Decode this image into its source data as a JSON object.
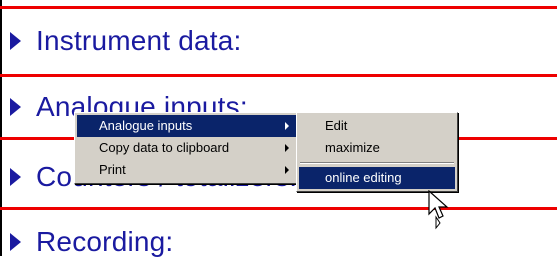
{
  "sections": [
    {
      "label": "Instrument data:"
    },
    {
      "label": "Analogue inputs:"
    },
    {
      "label": "Counters / totalizers:"
    },
    {
      "label": "Recording:"
    }
  ],
  "context_menu": {
    "items": [
      {
        "label": "Analogue inputs",
        "has_submenu": true,
        "highlighted": true
      },
      {
        "label": "Copy data to clipboard",
        "has_submenu": true,
        "highlighted": false
      },
      {
        "label": "Print",
        "has_submenu": true,
        "highlighted": false
      }
    ]
  },
  "submenu": {
    "items": [
      {
        "label": "Edit"
      },
      {
        "label": "maximize"
      },
      {
        "label": "online editing",
        "highlighted": true
      }
    ]
  },
  "icons": {
    "section_bullet": "triangle-right-icon",
    "submenu_arrow": "chevron-right-icon",
    "cursor": "mouse-pointer-icon"
  },
  "colors": {
    "section_text": "#1a1aa0",
    "divider": "#ee0000",
    "menu_bg": "#d4d0c8",
    "menu_highlight": "#0a246a"
  }
}
